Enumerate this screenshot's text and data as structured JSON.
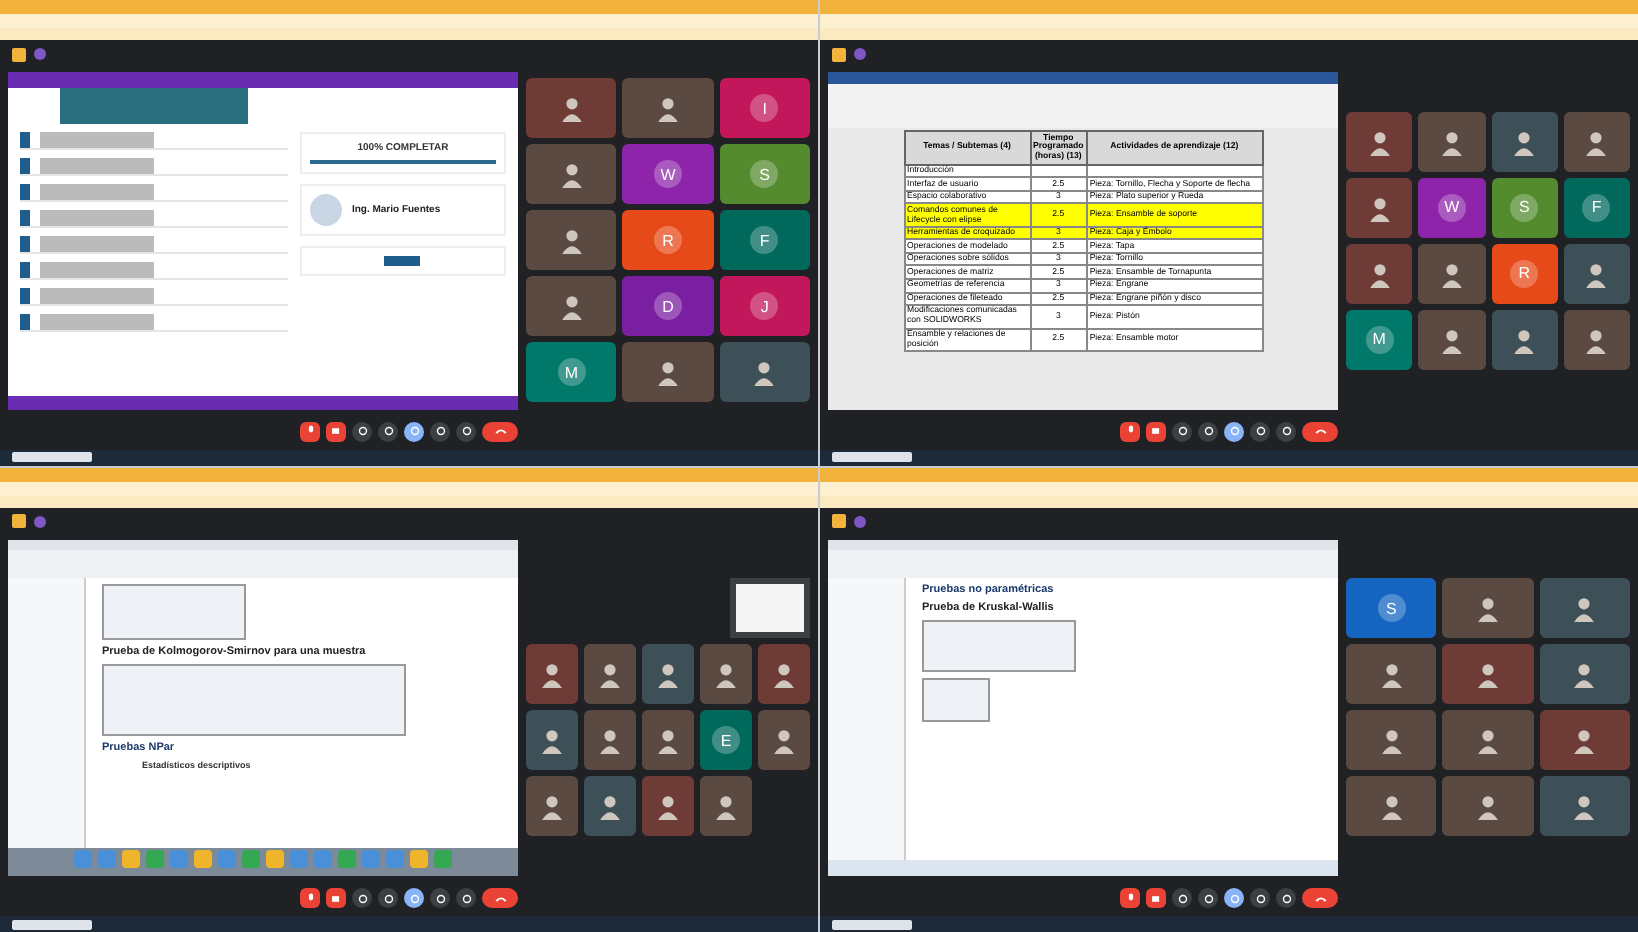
{
  "screens": [
    {
      "content": {
        "kind": "course",
        "completion_label": "100% COMPLETAR",
        "progress": {
          "level": 1
        },
        "instructor": "Ing. Mario Fuentes"
      },
      "tiles": [
        {
          "kind": "camera"
        },
        {
          "kind": "camera"
        },
        {
          "kind": "letter",
          "letter": "I",
          "color": "#c2185b"
        },
        {
          "kind": "camera"
        },
        {
          "kind": "letter",
          "letter": "W",
          "color": "#8e24aa"
        },
        {
          "kind": "letter",
          "letter": "S",
          "color": "#558b2f"
        },
        {
          "kind": "camera"
        },
        {
          "kind": "letter",
          "letter": "R",
          "color": "#e64a19"
        },
        {
          "kind": "letter",
          "letter": "F",
          "color": "#00695c"
        },
        {
          "kind": "camera"
        },
        {
          "kind": "letter",
          "letter": "D",
          "color": "#7b1fa2"
        },
        {
          "kind": "letter",
          "letter": "J",
          "color": "#c2185b"
        },
        {
          "kind": "letter",
          "letter": "M",
          "color": "#00796b"
        },
        {
          "kind": "camera"
        },
        {
          "kind": "camera"
        }
      ]
    },
    {
      "content": {
        "kind": "document",
        "columns": [
          "Temas / Subtemas (4)",
          "Tiempo Programado (horas) (13)",
          "Actividades de aprendizaje (12)"
        ],
        "rows": [
          {
            "cells": [
              "Introducción",
              "",
              ""
            ],
            "highlighted": false
          },
          {
            "cells": [
              "Interfaz de usuario",
              "2.5",
              "Pieza: Tornillo, Flecha y Soporte de flecha"
            ],
            "highlighted": false
          },
          {
            "cells": [
              "Espacio colaborativo",
              "3",
              "Pieza: Plato superior y Rueda"
            ],
            "highlighted": false
          },
          {
            "cells": [
              "Comandos comunes de Lifecycle con elipse",
              "2.5",
              "Pieza: Ensamble de soporte"
            ],
            "highlighted": true
          },
          {
            "cells": [
              "Herramientas de croquizado",
              "3",
              "Pieza: Caja y Émbolo"
            ],
            "highlighted": true
          },
          {
            "cells": [
              "Operaciones de modelado",
              "2.5",
              "Pieza: Tapa"
            ],
            "highlighted": false
          },
          {
            "cells": [
              "Operaciones sobre sólidos",
              "3",
              "Pieza: Tornillo"
            ],
            "highlighted": false
          },
          {
            "cells": [
              "Operaciones de matriz",
              "2.5",
              "Pieza: Ensamble de Tornapunta"
            ],
            "highlighted": false
          },
          {
            "cells": [
              "Geometrías de referencia",
              "3",
              "Pieza: Engrane"
            ],
            "highlighted": false
          },
          {
            "cells": [
              "Operaciones de fileteado",
              "2.5",
              "Pieza: Engrane piñón y disco"
            ],
            "highlighted": false
          },
          {
            "cells": [
              "Modificaciones comunicadas con SOLIDWORKS",
              "3",
              "Pieza: Pistón"
            ],
            "highlighted": false
          },
          {
            "cells": [
              "Ensamble y relaciones de posición",
              "2.5",
              "Pieza: Ensamble motor"
            ],
            "highlighted": false
          }
        ]
      },
      "tiles": [
        {
          "kind": "camera"
        },
        {
          "kind": "camera"
        },
        {
          "kind": "camera"
        },
        {
          "kind": "camera"
        },
        {
          "kind": "camera"
        },
        {
          "kind": "letter",
          "letter": "W",
          "color": "#8e24aa"
        },
        {
          "kind": "letter",
          "letter": "S",
          "color": "#558b2f"
        },
        {
          "kind": "letter",
          "letter": "F",
          "color": "#00695c"
        },
        {
          "kind": "camera"
        },
        {
          "kind": "camera"
        },
        {
          "kind": "letter",
          "letter": "R",
          "color": "#e64a19"
        },
        {
          "kind": "camera"
        },
        {
          "kind": "letter",
          "letter": "M",
          "color": "#00796b"
        },
        {
          "kind": "camera"
        },
        {
          "kind": "camera"
        },
        {
          "kind": "camera"
        }
      ]
    },
    {
      "content": {
        "kind": "stats",
        "heading": "Prueba de Kolmogorov-Smirnov para una muestra",
        "section": "Pruebas NPar",
        "subheading": "Estadísticos descriptivos"
      },
      "top_tile": {
        "kind": "slide"
      },
      "tiles": [
        {
          "kind": "camera"
        },
        {
          "kind": "camera"
        },
        {
          "kind": "camera"
        },
        {
          "kind": "camera"
        },
        {
          "kind": "camera"
        },
        {
          "kind": "camera"
        },
        {
          "kind": "camera"
        },
        {
          "kind": "camera"
        },
        {
          "kind": "letter",
          "letter": "E",
          "color": "#00695c"
        },
        {
          "kind": "camera"
        },
        {
          "kind": "camera"
        },
        {
          "kind": "camera"
        },
        {
          "kind": "camera"
        },
        {
          "kind": "camera"
        }
      ]
    },
    {
      "content": {
        "kind": "report",
        "section": "Pruebas no paramétricas",
        "heading": "Prueba de Kruskal-Wallis"
      },
      "tiles": [
        {
          "kind": "letter",
          "letter": "S",
          "color": "#1565c0"
        },
        {
          "kind": "camera"
        },
        {
          "kind": "camera"
        },
        {
          "kind": "camera"
        },
        {
          "kind": "camera"
        },
        {
          "kind": "camera"
        },
        {
          "kind": "camera"
        },
        {
          "kind": "camera"
        },
        {
          "kind": "camera"
        },
        {
          "kind": "camera"
        },
        {
          "kind": "camera"
        },
        {
          "kind": "camera"
        }
      ]
    }
  ],
  "controls": [
    {
      "kind": "mic",
      "on": false
    },
    {
      "kind": "camera",
      "on": false
    },
    {
      "kind": "captions"
    },
    {
      "kind": "emoji"
    },
    {
      "kind": "present",
      "on": true
    },
    {
      "kind": "hand"
    },
    {
      "kind": "more"
    },
    {
      "kind": "leave"
    }
  ]
}
